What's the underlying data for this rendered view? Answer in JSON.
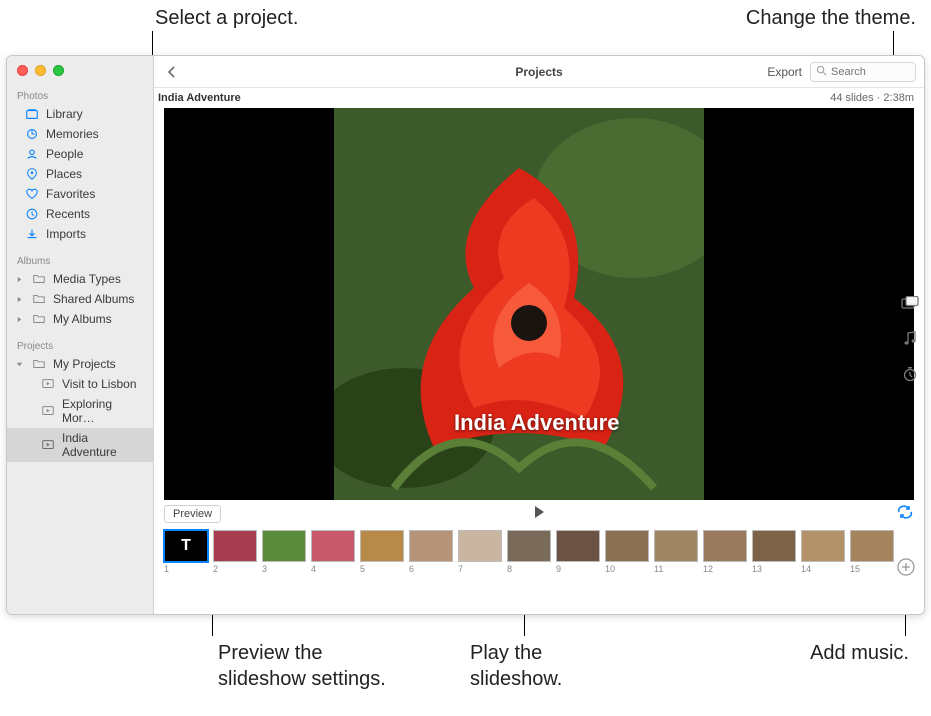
{
  "callouts": {
    "select_project": "Select a project.",
    "change_theme": "Change the theme.",
    "preview_settings": "Preview the\nslideshow settings.",
    "play_slideshow": "Play the\nslideshow.",
    "add_music": "Add music."
  },
  "sidebar": {
    "sections": {
      "photos": {
        "header": "Photos",
        "items": [
          {
            "label": "Library",
            "icon": "library"
          },
          {
            "label": "Memories",
            "icon": "memories"
          },
          {
            "label": "People",
            "icon": "people"
          },
          {
            "label": "Places",
            "icon": "places"
          },
          {
            "label": "Favorites",
            "icon": "heart"
          },
          {
            "label": "Recents",
            "icon": "clock"
          },
          {
            "label": "Imports",
            "icon": "download"
          }
        ]
      },
      "albums": {
        "header": "Albums",
        "items": [
          {
            "label": "Media Types"
          },
          {
            "label": "Shared Albums"
          },
          {
            "label": "My Albums"
          }
        ]
      },
      "projects": {
        "header": "Projects",
        "root": "My Projects",
        "items": [
          {
            "label": "Visit to Lisbon"
          },
          {
            "label": "Exploring Mor…"
          },
          {
            "label": "India Adventure",
            "selected": true
          }
        ]
      }
    }
  },
  "toolbar": {
    "title": "Projects",
    "export_label": "Export",
    "search_placeholder": "Search"
  },
  "project": {
    "title": "India Adventure",
    "meta": "44 slides · 2:38m",
    "caption": "India Adventure"
  },
  "controls": {
    "preview_label": "Preview"
  },
  "thumbnails": [
    {
      "num": "1",
      "title": true
    },
    {
      "num": "2"
    },
    {
      "num": "3"
    },
    {
      "num": "4"
    },
    {
      "num": "5"
    },
    {
      "num": "6"
    },
    {
      "num": "7"
    },
    {
      "num": "8"
    },
    {
      "num": "9"
    },
    {
      "num": "10"
    },
    {
      "num": "11"
    },
    {
      "num": "12"
    },
    {
      "num": "13"
    },
    {
      "num": "14"
    },
    {
      "num": "15"
    }
  ],
  "thumb_colors": [
    "#000",
    "#a83d52",
    "#5a8b3a",
    "#c95a6e",
    "#b88a4a",
    "#b5947a",
    "#c9b5a2",
    "#7a6a5a",
    "#6b5343",
    "#8a6f52",
    "#a08664",
    "#9a7a5c",
    "#7d6248",
    "#b3926a",
    "#a58560"
  ]
}
